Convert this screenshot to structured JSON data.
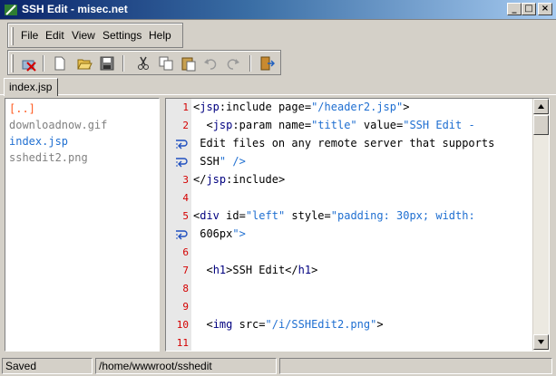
{
  "window": {
    "title": "SSH Edit - misec.net",
    "minimize": "_",
    "maximize": "□",
    "close": "×"
  },
  "menu": [
    "File",
    "Edit",
    "View",
    "Settings",
    "Help"
  ],
  "toolbar": {
    "buttons": [
      "disconnect-icon",
      "new-file-icon",
      "open-folder-icon",
      "save-icon",
      "cut-icon",
      "copy-icon",
      "paste-icon",
      "undo-icon",
      "redo-icon",
      "exit-icon"
    ]
  },
  "tabs": [
    {
      "label": "index.jsp"
    }
  ],
  "files": [
    {
      "name": "[..]",
      "color": "#ff5a1f"
    },
    {
      "name": "downloadnow.gif",
      "color": "#808080"
    },
    {
      "name": "index.jsp",
      "color": "#1f6fd1"
    },
    {
      "name": "sshedit2.png",
      "color": "#808080"
    }
  ],
  "editor": {
    "lines": [
      {
        "num": "1",
        "text": "<jsp:include page=\"/header2.jsp\">"
      },
      {
        "num": "2",
        "text": "  <jsp:param name=\"title\" value=\"SSH Edit -"
      },
      {
        "num": "",
        "wrap": true,
        "text": " Edit files on any remote server that supports"
      },
      {
        "num": "",
        "wrap": true,
        "text": " SSH\" />"
      },
      {
        "num": "3",
        "text": "</jsp:include>"
      },
      {
        "num": "4",
        "text": ""
      },
      {
        "num": "5",
        "text": "<div id=\"left\" style=\"padding: 30px; width:"
      },
      {
        "num": "",
        "wrap": true,
        "text": " 606px\">"
      },
      {
        "num": "6",
        "text": ""
      },
      {
        "num": "7",
        "text": "  <h1>SSH Edit</h1>"
      },
      {
        "num": "8",
        "text": ""
      },
      {
        "num": "9",
        "text": ""
      },
      {
        "num": "10",
        "text": "  <img src=\"/i/SSHEdit2.png\">"
      },
      {
        "num": "11",
        "text": ""
      }
    ]
  },
  "status": {
    "state": "Saved",
    "path": "/home/wwwroot/sshedit"
  }
}
